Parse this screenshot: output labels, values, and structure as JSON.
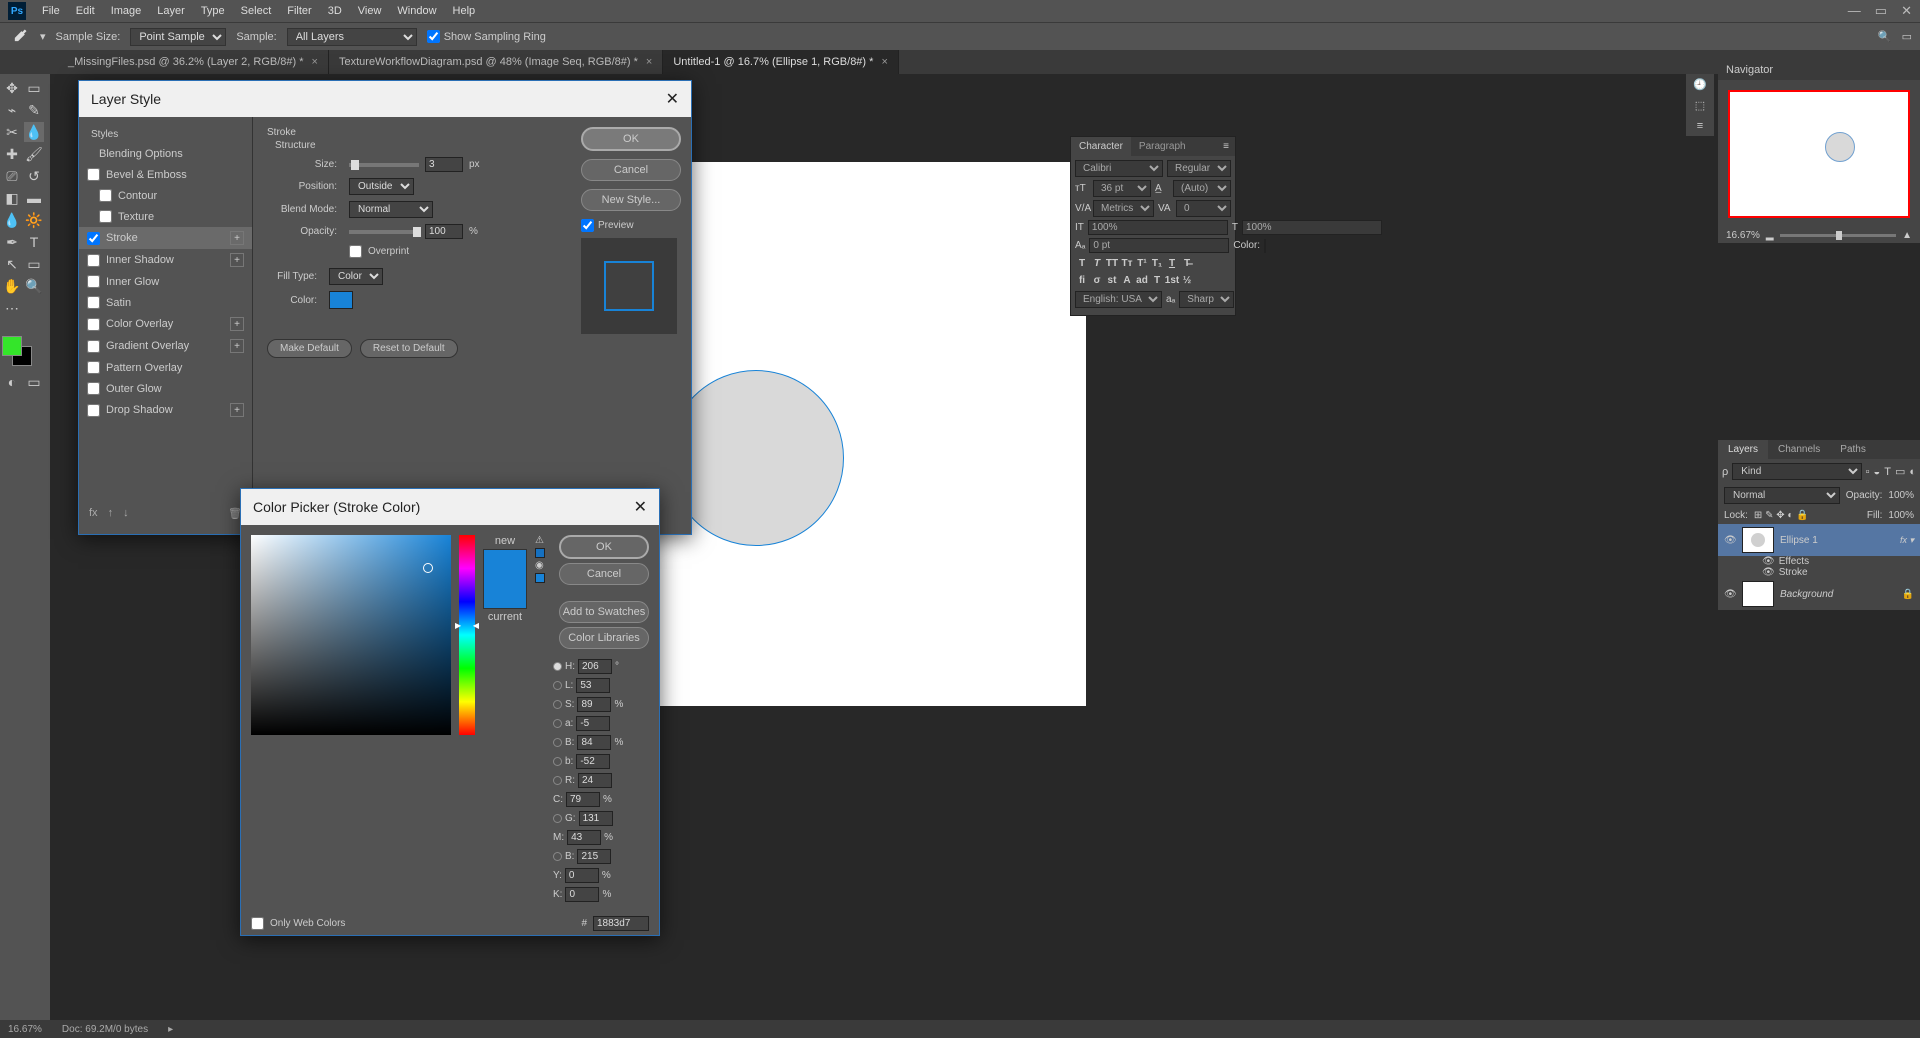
{
  "menubar": {
    "items": [
      "File",
      "Edit",
      "Image",
      "Layer",
      "Type",
      "Select",
      "Filter",
      "3D",
      "View",
      "Window",
      "Help"
    ]
  },
  "options_bar": {
    "sample_size_label": "Sample Size:",
    "sample_size_value": "Point Sample",
    "sample_label": "Sample:",
    "sample_value": "All Layers",
    "show_sampling_ring": "Show Sampling Ring"
  },
  "tabs": [
    {
      "label": "_MissingFiles.psd @ 36.2% (Layer 2, RGB/8#) *",
      "active": false
    },
    {
      "label": "TextureWorkflowDiagram.psd @ 48% (Image Seq, RGB/8#) *",
      "active": false
    },
    {
      "label": "Untitled-1 @ 16.7% (Ellipse 1, RGB/8#) *",
      "active": true
    }
  ],
  "layer_style": {
    "title": "Layer Style",
    "styles_header": "Styles",
    "blending_options": "Blending Options",
    "effects": [
      {
        "name": "Bevel & Emboss",
        "checked": false,
        "plus": false
      },
      {
        "name": "Contour",
        "checked": false,
        "plus": false,
        "indent": true
      },
      {
        "name": "Texture",
        "checked": false,
        "plus": false,
        "indent": true
      },
      {
        "name": "Stroke",
        "checked": true,
        "plus": true,
        "active": true
      },
      {
        "name": "Inner Shadow",
        "checked": false,
        "plus": true
      },
      {
        "name": "Inner Glow",
        "checked": false,
        "plus": false
      },
      {
        "name": "Satin",
        "checked": false,
        "plus": false
      },
      {
        "name": "Color Overlay",
        "checked": false,
        "plus": true
      },
      {
        "name": "Gradient Overlay",
        "checked": false,
        "plus": true
      },
      {
        "name": "Pattern Overlay",
        "checked": false,
        "plus": false
      },
      {
        "name": "Outer Glow",
        "checked": false,
        "plus": false
      },
      {
        "name": "Drop Shadow",
        "checked": false,
        "plus": true
      }
    ],
    "stroke": {
      "section": "Stroke",
      "structure": "Structure",
      "size_label": "Size:",
      "size_value": "3",
      "size_unit": "px",
      "position_label": "Position:",
      "position_value": "Outside",
      "blend_mode_label": "Blend Mode:",
      "blend_mode_value": "Normal",
      "opacity_label": "Opacity:",
      "opacity_value": "100",
      "opacity_unit": "%",
      "overprint": "Overprint",
      "fill_type_label": "Fill Type:",
      "fill_type_value": "Color",
      "color_label": "Color:",
      "make_default": "Make Default",
      "reset_default": "Reset to Default"
    },
    "side": {
      "ok": "OK",
      "cancel": "Cancel",
      "new_style": "New Style...",
      "preview": "Preview"
    }
  },
  "color_picker": {
    "title": "Color Picker (Stroke Color)",
    "new": "new",
    "current": "current",
    "ok": "OK",
    "cancel": "Cancel",
    "add_swatches": "Add to Swatches",
    "color_libraries": "Color Libraries",
    "only_web": "Only Web Colors",
    "hex": "1883d7",
    "values": {
      "H": "206",
      "S": "89",
      "B": "84",
      "R": "24",
      "G": "131",
      "Bv": "215",
      "L": "53",
      "a": "-5",
      "b": "-52",
      "C": "79",
      "M": "43",
      "Y": "0",
      "K": "0"
    }
  },
  "character": {
    "tab1": "Character",
    "tab2": "Paragraph",
    "font": "Calibri",
    "style": "Regular",
    "size": "36 pt",
    "leading": "(Auto)",
    "va": "Metrics",
    "tracking": "0",
    "vscale": "100%",
    "hscale": "100%",
    "baseline": "0 pt",
    "color_label": "Color:",
    "language": "English: USA",
    "aa": "Sharp"
  },
  "navigator": {
    "title": "Navigator",
    "zoom": "16.67%"
  },
  "layers": {
    "tabs": [
      "Layers",
      "Channels",
      "Paths"
    ],
    "kind": "Kind",
    "blend": "Normal",
    "opacity_label": "Opacity:",
    "opacity": "100%",
    "lock_label": "Lock:",
    "fill_label": "Fill:",
    "fill": "100%",
    "layer1": "Ellipse 1",
    "effects": "Effects",
    "stroke": "Stroke",
    "background": "Background"
  },
  "status": {
    "zoom": "16.67%",
    "doc": "Doc: 69.2M/0 bytes"
  }
}
